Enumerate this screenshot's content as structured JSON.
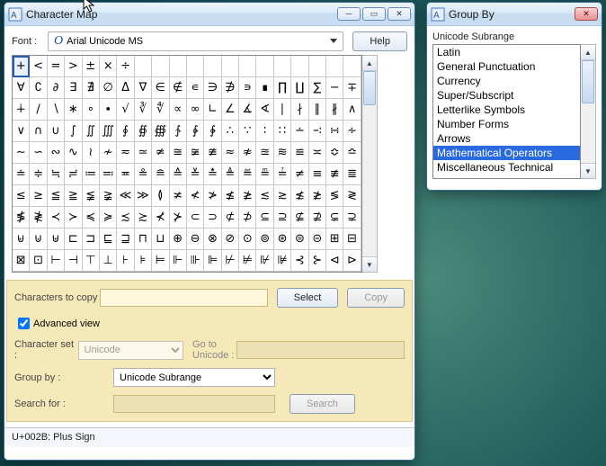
{
  "charmap": {
    "title": "Character Map",
    "font_label": "Font :",
    "font_value": "Arial Unicode MS",
    "help_label": "Help",
    "grid": [
      "+",
      "<",
      "=",
      ">",
      "±",
      "×",
      "÷",
      "",
      "",
      "",
      "",
      "",
      "",
      "",
      "",
      "",
      "",
      "",
      "",
      "",
      "∀",
      "∁",
      "∂",
      "∃",
      "∄",
      "∅",
      "Δ",
      "∇",
      "∈",
      "∉",
      "∊",
      "∋",
      "∌",
      "∍",
      "∎",
      "∏",
      "∐",
      "∑",
      "−",
      "∓",
      "∔",
      "∕",
      "∖",
      "∗",
      "∘",
      "∙",
      "√",
      "∛",
      "∜",
      "∝",
      "∞",
      "∟",
      "∠",
      "∡",
      "∢",
      "∣",
      "∤",
      "∥",
      "∦",
      "∧",
      "∨",
      "∩",
      "∪",
      "∫",
      "∬",
      "∭",
      "∮",
      "∯",
      "∰",
      "∱",
      "∲",
      "∳",
      "∴",
      "∵",
      "∶",
      "∷",
      "∸",
      "∹",
      "∺",
      "∻",
      "∼",
      "∽",
      "∾",
      "∿",
      "≀",
      "≁",
      "≂",
      "≃",
      "≄",
      "≅",
      "≆",
      "≇",
      "≈",
      "≉",
      "≊",
      "≋",
      "≌",
      "≍",
      "≎",
      "≏",
      "≐",
      "≑",
      "≒",
      "≓",
      "≔",
      "≕",
      "≖",
      "≗",
      "≘",
      "≙",
      "≚",
      "≛",
      "≜",
      "≝",
      "≞",
      "≟",
      "≠",
      "≡",
      "≢",
      "≣",
      "≤",
      "≥",
      "≦",
      "≧",
      "≨",
      "≩",
      "≪",
      "≫",
      "≬",
      "≭",
      "≮",
      "≯",
      "≰",
      "≱",
      "≲",
      "≳",
      "≴",
      "≵",
      "≶",
      "≷",
      "≸",
      "≹",
      "≺",
      "≻",
      "≼",
      "≽",
      "≾",
      "≿",
      "⊀",
      "⊁",
      "⊂",
      "⊃",
      "⊄",
      "⊅",
      "⊆",
      "⊇",
      "⊈",
      "⊉",
      "⊊",
      "⊋",
      "⊌",
      "⊍",
      "⊎",
      "⊏",
      "⊐",
      "⊑",
      "⊒",
      "⊓",
      "⊔",
      "⊕",
      "⊖",
      "⊗",
      "⊘",
      "⊙",
      "⊚",
      "⊛",
      "⊜",
      "⊝",
      "⊞",
      "⊟",
      "⊠",
      "⊡",
      "⊢",
      "⊣",
      "⊤",
      "⊥",
      "⊦",
      "⊧",
      "⊨",
      "⊩",
      "⊪",
      "⊫",
      "⊬",
      "⊭",
      "⊮",
      "⊯",
      "⊰",
      "⊱",
      "⊲",
      "⊳"
    ],
    "selected_index": 0,
    "chars_to_copy_label": "Characters to copy",
    "chars_to_copy_value": "",
    "select_label": "Select",
    "copy_label": "Copy",
    "advanced_view_label": "Advanced view",
    "advanced_checked": true,
    "charset_label": "Character set :",
    "charset_value": "Unicode",
    "goto_label": "Go to Unicode :",
    "goto_value": "",
    "groupby_label": "Group by :",
    "groupby_value": "Unicode Subrange",
    "search_label": "Search for :",
    "search_value": "",
    "search_btn": "Search",
    "status": "U+002B: Plus Sign"
  },
  "groupby": {
    "title": "Group By",
    "heading": "Unicode Subrange",
    "items": [
      "Latin",
      "General Punctuation",
      "Currency",
      "Super/Subscript",
      "Letterlike Symbols",
      "Number Forms",
      "Arrows",
      "Mathematical Operators",
      "Miscellaneous Technical"
    ],
    "selected_index": 7
  }
}
